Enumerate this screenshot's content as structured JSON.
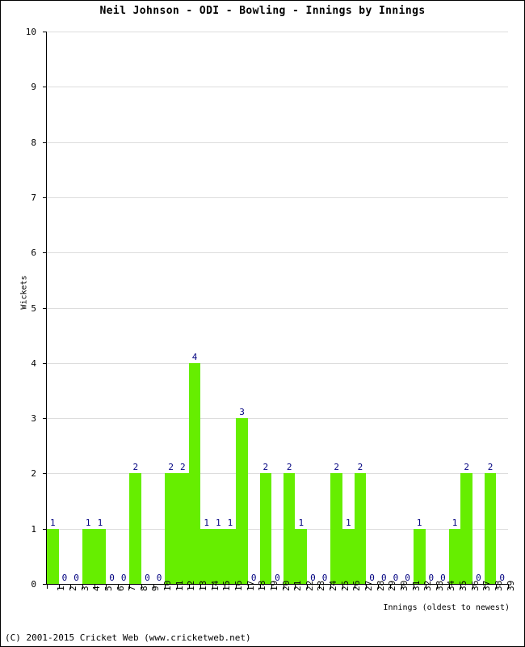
{
  "title": "Neil Johnson - ODI - Bowling - Innings by Innings",
  "footer": "(C) 2001-2015 Cricket Web (www.cricketweb.net)",
  "axis": {
    "ylabel": "Wickets",
    "xlabel": "Innings (oldest to newest)"
  },
  "colors": {
    "bar": "#66ee00",
    "label": "#000080",
    "grid": "#dddddd",
    "axis": "#000000",
    "background": "#ffffff"
  },
  "chart_data": {
    "type": "bar",
    "title": "Neil Johnson - ODI - Bowling - Innings by Innings",
    "xlabel": "Innings (oldest to newest)",
    "ylabel": "Wickets",
    "ylim": [
      0,
      10
    ],
    "yticks": [
      0,
      1,
      2,
      3,
      4,
      5,
      6,
      7,
      8,
      9,
      10
    ],
    "grid": true,
    "legend": null,
    "categories": [
      "1",
      "2",
      "3",
      "4",
      "5",
      "6",
      "7",
      "8",
      "9",
      "10",
      "11",
      "12",
      "13",
      "14",
      "15",
      "16",
      "17",
      "18",
      "19",
      "20",
      "21",
      "22",
      "23",
      "24",
      "25",
      "26",
      "27",
      "28",
      "29",
      "30",
      "31",
      "32",
      "33",
      "34",
      "35",
      "36",
      "37",
      "38",
      "39"
    ],
    "values": [
      1,
      0,
      0,
      1,
      1,
      0,
      0,
      2,
      0,
      0,
      2,
      2,
      4,
      1,
      1,
      1,
      3,
      0,
      2,
      0,
      2,
      1,
      0,
      0,
      2,
      1,
      2,
      0,
      0,
      0,
      0,
      1,
      0,
      0,
      1,
      2,
      0,
      2,
      0
    ],
    "data_labels": [
      "1",
      "0",
      "0",
      "1",
      "1",
      "0",
      "0",
      "2",
      "0",
      "0",
      "2",
      "2",
      "4",
      "1",
      "1",
      "1",
      "3",
      "0",
      "2",
      "0",
      "2",
      "1",
      "0",
      "0",
      "2",
      "1",
      "2",
      "0",
      "0",
      "0",
      "0",
      "1",
      "0",
      "0",
      "1",
      "2",
      "0",
      "2",
      "0"
    ]
  }
}
